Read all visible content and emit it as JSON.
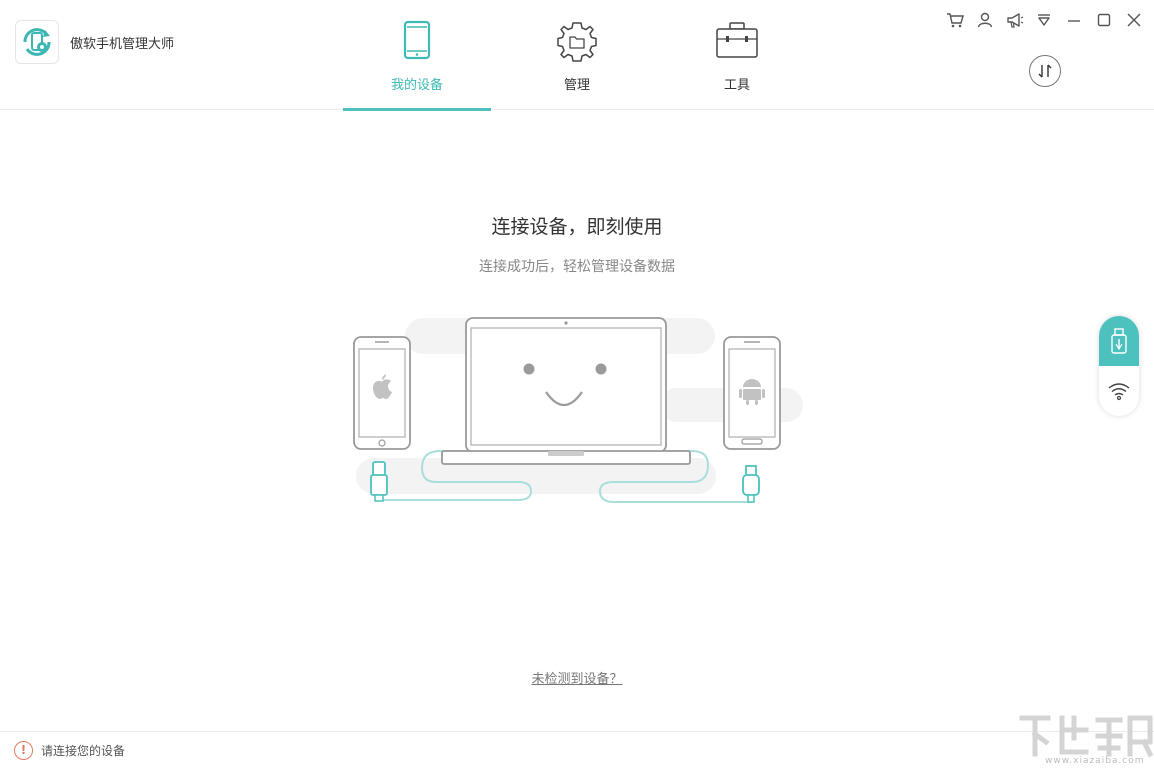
{
  "app": {
    "title": "傲软手机管理大师"
  },
  "nav": {
    "tabs": [
      {
        "label": "我的设备",
        "active": true
      },
      {
        "label": "管理",
        "active": false
      },
      {
        "label": "工具",
        "active": false
      }
    ]
  },
  "window_controls": [
    "cart-icon",
    "user-icon",
    "megaphone-icon",
    "menu-icon",
    "minimize-icon",
    "maximize-icon",
    "close-icon"
  ],
  "main": {
    "title": "连接设备，即刻使用",
    "subtitle": "连接成功后，轻松管理设备数据",
    "help_link": "未检测到设备？"
  },
  "side_dock": [
    "usb-icon",
    "wifi-icon"
  ],
  "status": {
    "text": "请连接您的设备",
    "icon": "!"
  },
  "watermark": {
    "text": "www.xiazaiba.com"
  },
  "colors": {
    "accent": "#4cc1bd",
    "warning": "#e07a5f"
  }
}
